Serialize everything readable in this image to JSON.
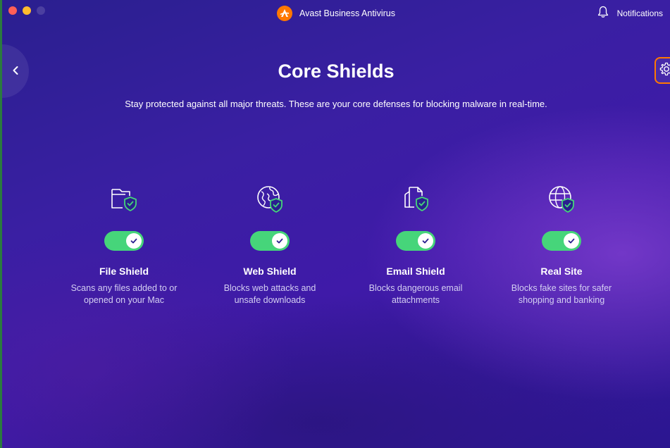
{
  "window": {
    "title": "Avast Business Antivirus",
    "notifications_label": "Notifications"
  },
  "icons": {
    "app_logo": "avast-logo-icon",
    "notifications": "bell-icon",
    "back": "chevron-left-icon",
    "settings": "gear-icon",
    "toggle_check": "check-icon"
  },
  "colors": {
    "accent_orange": "#ff7800",
    "toggle_on": "#46d57a",
    "shield_green": "#46d57a",
    "background": "#3a1fa3"
  },
  "page": {
    "title": "Core Shields",
    "subtitle": "Stay protected against all major threats. These are your core defenses for blocking malware in real-time."
  },
  "shields": [
    {
      "name": "File Shield",
      "desc_line1": "Scans any files added to or",
      "desc_line2": "opened on your Mac",
      "enabled": true,
      "icon": "folder-shield-icon"
    },
    {
      "name": "Web Shield",
      "desc_line1": "Blocks web attacks and",
      "desc_line2": "unsafe downloads",
      "enabled": true,
      "icon": "globe-shield-icon"
    },
    {
      "name": "Email Shield",
      "desc_line1": "Blocks dangerous email",
      "desc_line2": "attachments",
      "enabled": true,
      "icon": "document-shield-icon"
    },
    {
      "name": "Real Site",
      "desc_line1": "Blocks fake sites for safer",
      "desc_line2": "shopping and banking",
      "enabled": true,
      "icon": "web-shield-icon"
    }
  ]
}
